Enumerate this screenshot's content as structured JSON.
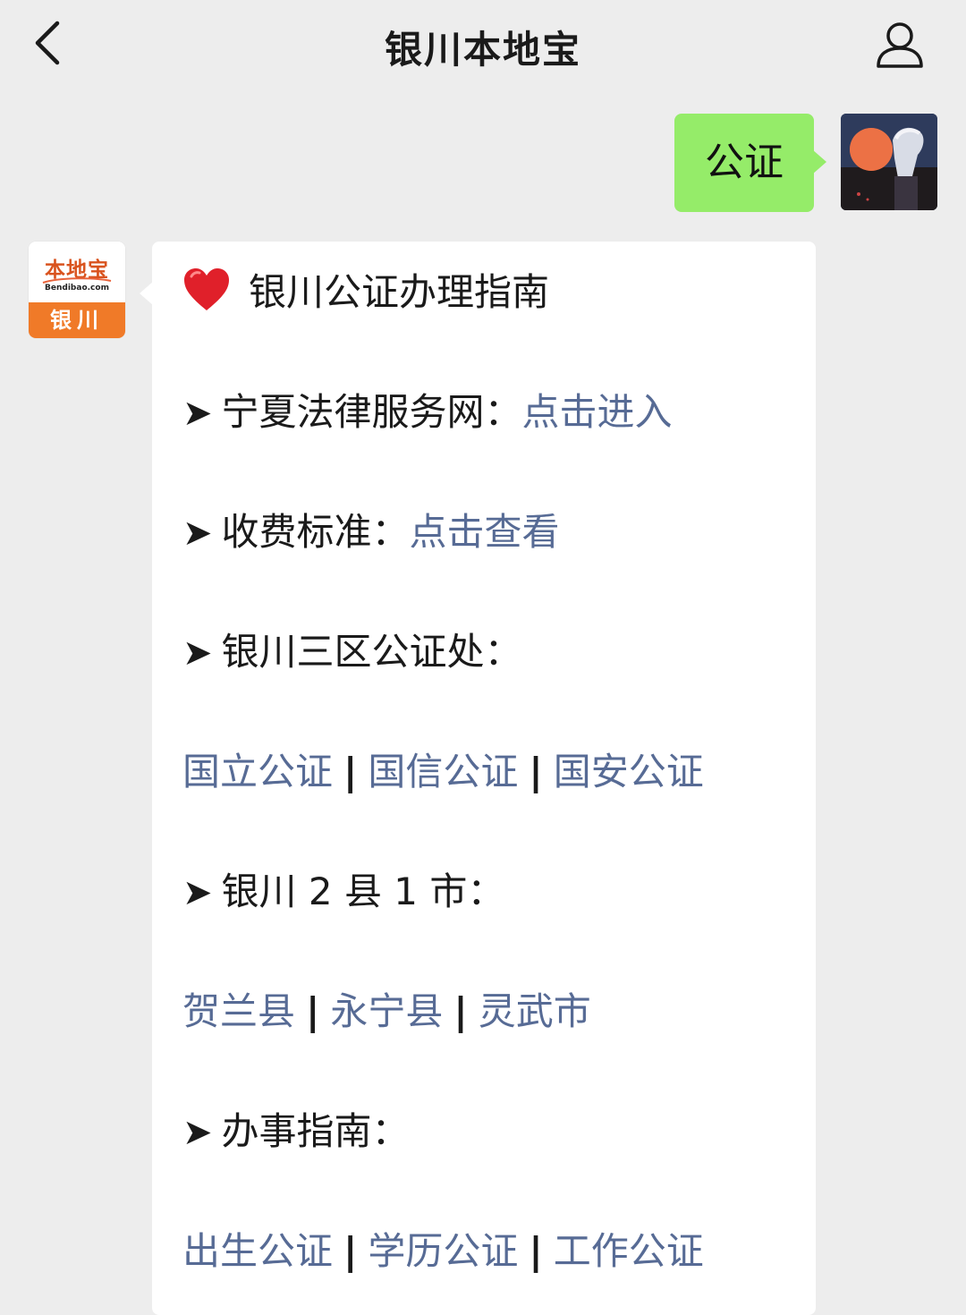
{
  "header": {
    "title": "银川本地宝",
    "back_icon": "chevron-left-icon",
    "profile_icon": "person-icon"
  },
  "outgoing_message": {
    "text": "公证",
    "bubble_color": "#95ec69"
  },
  "bot": {
    "avatar_logo_cn": "本地宝",
    "avatar_logo_en": "Bendibao.com",
    "avatar_city": "银川",
    "accent_color": "#f07a28"
  },
  "reply": {
    "heading_icon": "red-heart-icon",
    "heading": "银川公证办理指南",
    "arrow_glyph": "➤",
    "link_color": "#576b95",
    "items": [
      {
        "label": "宁夏法律服务网：",
        "link": "点击进入"
      },
      {
        "label": "收费标准：",
        "link": "点击查看"
      },
      {
        "label": "银川三区公证处："
      },
      {
        "label": "银川 2 县 1 市："
      },
      {
        "label": "办事指南："
      }
    ],
    "offices": [
      "国立公证",
      "国信公证",
      "国安公证"
    ],
    "counties": [
      "贺兰县",
      "永宁县",
      "灵武市"
    ],
    "guides": [
      "出生公证",
      "学历公证",
      "工作公证"
    ],
    "separator": "|"
  }
}
